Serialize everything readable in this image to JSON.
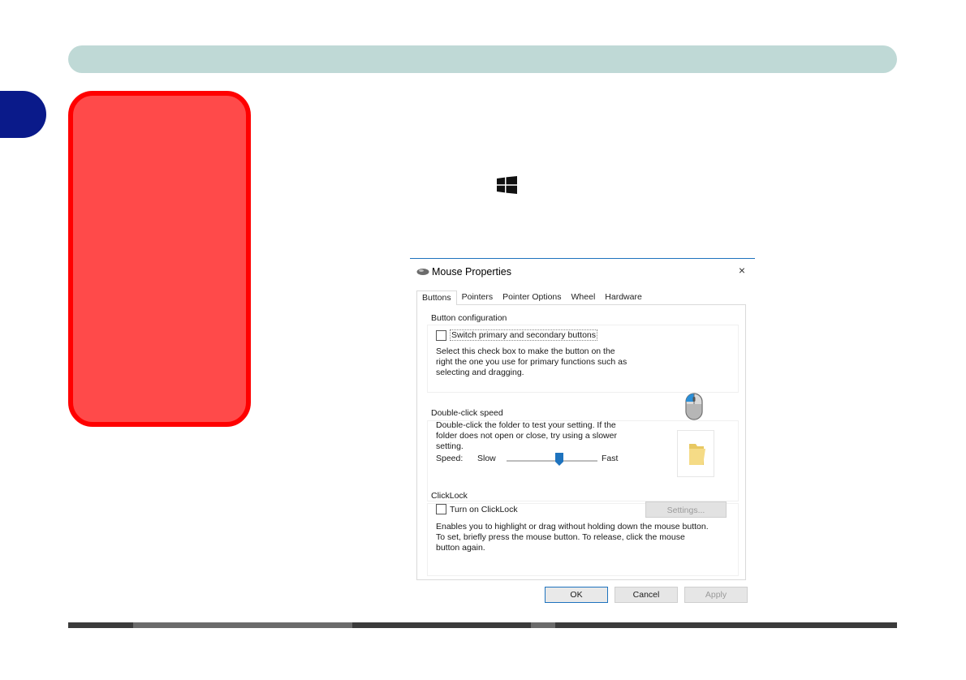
{
  "side_tab": {
    "color": "#0a1a8a"
  },
  "note_box": {
    "fill": "#ff4a4a",
    "border": "#ff0000"
  },
  "dialog": {
    "title": "Mouse Properties",
    "close_glyph": "×",
    "tabs": [
      "Buttons",
      "Pointers",
      "Pointer Options",
      "Wheel",
      "Hardware"
    ],
    "active_tab": "Buttons",
    "button_configuration": {
      "label": "Button configuration",
      "checkbox_label": "Switch primary and secondary buttons",
      "checked": false,
      "description": [
        "Select this check box to make the button on the",
        "right the one you use for primary functions such as",
        "selecting and dragging."
      ]
    },
    "double_click": {
      "label": "Double-click speed",
      "description": [
        "Double-click the folder to test your setting. If the",
        "folder does not open or close, try using a slower",
        "setting."
      ],
      "speed_label": "Speed:",
      "slow_label": "Slow",
      "fast_label": "Fast",
      "speed_level": 0.58
    },
    "clicklock": {
      "label": "ClickLock",
      "checkbox_label": "Turn on ClickLock",
      "checked": false,
      "settings_button": "Settings...",
      "description": [
        "Enables you to highlight or drag without holding down the mouse button.",
        "To set, briefly press the mouse button. To release, click the mouse",
        "button again."
      ]
    },
    "buttons": {
      "ok": "OK",
      "cancel": "Cancel",
      "apply": "Apply"
    }
  }
}
